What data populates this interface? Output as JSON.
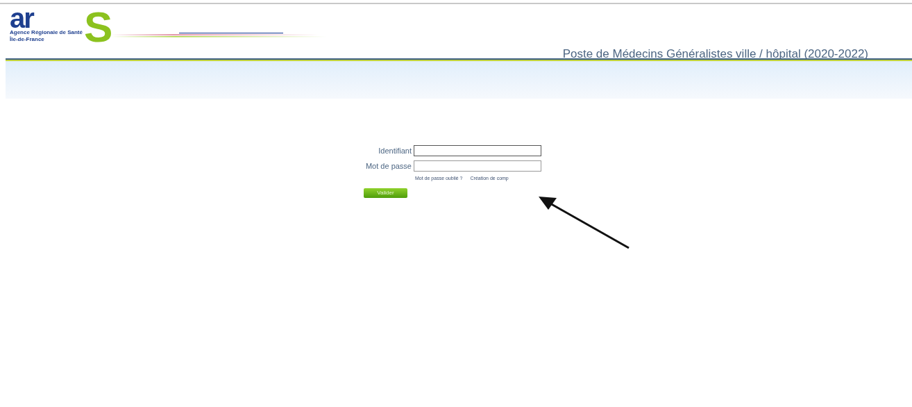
{
  "logo": {
    "letters": "ar",
    "big_letter": "S",
    "line_1": "Agence Régionale de Santé",
    "line_2": "Île-de-France"
  },
  "header": {
    "title": "Poste de Médecins Généralistes ville / hôpital (2020-2022)"
  },
  "login_form": {
    "fields": [
      {
        "label": "Identifiant",
        "focused": true
      },
      {
        "label": "Mot de passe",
        "focused": false
      }
    ],
    "links": [
      "Mot de passe oublié ?",
      "Création de comp"
    ],
    "submit": "Valider"
  }
}
